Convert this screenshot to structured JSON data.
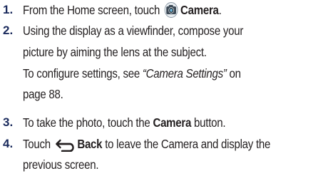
{
  "steps": [
    {
      "number": "1.",
      "lines": [
        {
          "pre": "From the Home screen, touch ",
          "icon": "camera-icon",
          "bold": "Camera",
          "post": "."
        }
      ]
    },
    {
      "number": "2.",
      "lines": [
        {
          "text": "Using the display as a viewfinder, compose your"
        },
        {
          "text": "picture by aiming the lens at the subject."
        },
        {
          "pre": "To configure settings, see ",
          "italic": "“Camera Settings”",
          "post": " on"
        },
        {
          "text": "page 88."
        }
      ]
    },
    {
      "number": "3.",
      "lines": [
        {
          "pre": "To take the photo, touch the ",
          "bold": "Camera",
          "post": " button."
        }
      ]
    },
    {
      "number": "4.",
      "lines": [
        {
          "pre": "Touch ",
          "icon": "back-arrow-icon",
          "bold": "Back",
          "post": " to leave the Camera and display the"
        },
        {
          "text": "previous screen."
        }
      ]
    }
  ],
  "colors": {
    "number": "#1a2a5c",
    "text": "#231f20",
    "icon_dark": "#3d4a56",
    "icon_lens": "#6fb4d8"
  }
}
